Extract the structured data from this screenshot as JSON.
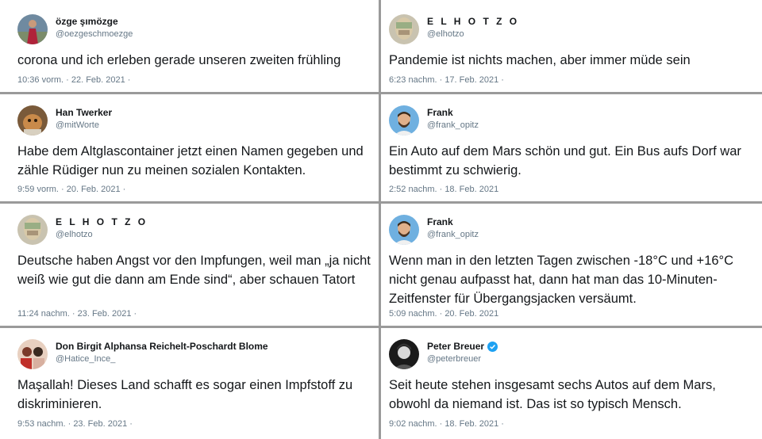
{
  "tweets": [
    {
      "name": "özge şımözge",
      "handle": "@oezgeschmoezge",
      "text": "corona und ich erleben gerade unseren zweiten frühling",
      "meta": "10:36 vorm. · 22. Feb. 2021 ·",
      "avatar_icon": "woman-red-dress-avatar"
    },
    {
      "name": "E L H O T Z O",
      "handle": "@elhotzo",
      "text": "Pandemie ist nichts machen, aber immer müde sein",
      "meta": "6:23 nachm. · 17. Feb. 2021 ·",
      "avatar_icon": "pixelated-face-avatar"
    },
    {
      "name": "Han Twerker",
      "handle": "@mitWorte",
      "text": "Habe dem Altglascontainer jetzt einen Namen gegeben und zähle Rüdiger nun zu meinen sozialen Kontakten.",
      "meta": "9:59 vorm. · 20. Feb. 2021 ·",
      "avatar_icon": "dog-avatar"
    },
    {
      "name": "Frank",
      "handle": "@frank_opitz",
      "text": "Ein Auto auf dem Mars schön und gut. Ein Bus aufs Dorf war bestimmt zu schwierig.",
      "meta": "2:52 nachm. · 18. Feb. 2021",
      "avatar_icon": "bearded-man-avatar"
    },
    {
      "name": "E L H O T Z O",
      "handle": "@elhotzo",
      "text": "Deutsche haben Angst vor den Impfungen, weil man „ja nicht weiß wie gut die dann am Ende sind“, aber schauen Tatort",
      "meta": "11:24 nachm. · 23. Feb. 2021 ·",
      "avatar_icon": "pixelated-face-avatar"
    },
    {
      "name": "Frank",
      "handle": "@frank_opitz",
      "text": "Wenn man in den letzten Tagen zwischen -18°C und +16°C nicht genau aufpasst hat, dann hat man das 10-Minuten-Zeitfenster für Übergangsjacken versäumt.",
      "meta": "5:09 nachm. · 20. Feb. 2021",
      "avatar_icon": "bearded-man-avatar"
    },
    {
      "name": "Don Birgit Alphansa Reichelt-Poschardt Blome",
      "handle": "@Hatice_Ince_",
      "text": "Maşallah! Dieses Land schafft es sogar einen Impfstoff zu diskriminieren.",
      "meta": "9:53 nachm. · 23. Feb. 2021 ·",
      "avatar_icon": "group-photo-avatar"
    },
    {
      "name": "Peter Breuer",
      "handle": "@peterbreuer",
      "text": "Seit heute stehen insgesamt sechs Autos auf dem Mars, obwohl da niemand ist. Das ist so typisch Mensch.",
      "meta": "9:02 nachm. · 18. Feb. 2021 ·",
      "avatar_icon": "bw-portrait-avatar",
      "verified": true
    }
  ],
  "colors": {
    "divider": "#9a9a9a",
    "text": "#14171a",
    "muted": "#657786",
    "verified": "#1da1f2"
  }
}
